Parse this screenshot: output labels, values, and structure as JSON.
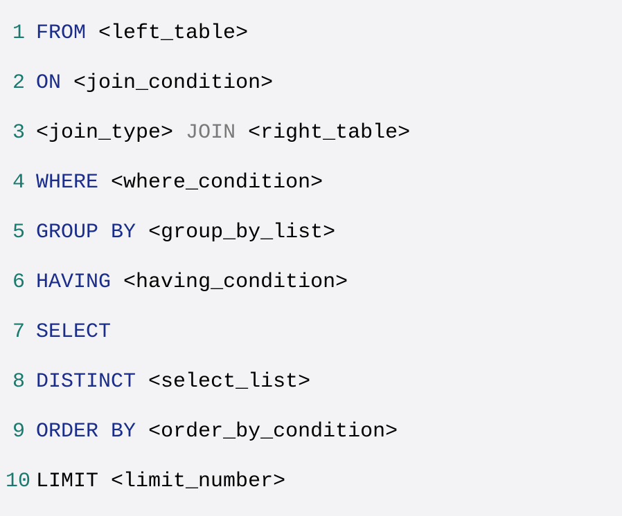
{
  "colors": {
    "background": "#f3f2f4",
    "lineNumber": "#1a7a6f",
    "keywordBlue": "#1a2d8a",
    "keywordGray": "#7a7a7a",
    "textBlack": "#000000"
  },
  "lines": [
    {
      "number": "1",
      "tokens": [
        {
          "text": "FROM",
          "class": "kw-blue"
        },
        {
          "text": " ",
          "class": "txt-black"
        },
        {
          "text": "<left_table>",
          "class": "txt-black"
        }
      ]
    },
    {
      "number": "2",
      "tokens": [
        {
          "text": "ON",
          "class": "kw-blue"
        },
        {
          "text": " ",
          "class": "txt-black"
        },
        {
          "text": "<join_condition>",
          "class": "txt-black"
        }
      ]
    },
    {
      "number": "3",
      "tokens": [
        {
          "text": "<join_type>",
          "class": "txt-black"
        },
        {
          "text": " ",
          "class": "txt-black"
        },
        {
          "text": "JOIN",
          "class": "kw-gray"
        },
        {
          "text": " ",
          "class": "txt-black"
        },
        {
          "text": "<right_table>",
          "class": "txt-black"
        }
      ]
    },
    {
      "number": "4",
      "tokens": [
        {
          "text": "WHERE",
          "class": "kw-blue"
        },
        {
          "text": " ",
          "class": "txt-black"
        },
        {
          "text": "<where_condition>",
          "class": "txt-black"
        }
      ]
    },
    {
      "number": "5",
      "tokens": [
        {
          "text": "GROUP",
          "class": "kw-blue"
        },
        {
          "text": " ",
          "class": "txt-black"
        },
        {
          "text": "BY",
          "class": "kw-blue"
        },
        {
          "text": " ",
          "class": "txt-black"
        },
        {
          "text": "<group_by_list>",
          "class": "txt-black"
        }
      ]
    },
    {
      "number": "6",
      "tokens": [
        {
          "text": "HAVING",
          "class": "kw-blue"
        },
        {
          "text": " ",
          "class": "txt-black"
        },
        {
          "text": "<having_condition>",
          "class": "txt-black"
        }
      ]
    },
    {
      "number": "7",
      "tokens": [
        {
          "text": "SELECT",
          "class": "kw-blue"
        }
      ]
    },
    {
      "number": "8",
      "tokens": [
        {
          "text": "DISTINCT",
          "class": "kw-blue"
        },
        {
          "text": " ",
          "class": "txt-black"
        },
        {
          "text": "<select_list>",
          "class": "txt-black"
        }
      ]
    },
    {
      "number": "9",
      "tokens": [
        {
          "text": "ORDER",
          "class": "kw-blue"
        },
        {
          "text": " ",
          "class": "txt-black"
        },
        {
          "text": "BY",
          "class": "kw-blue"
        },
        {
          "text": " ",
          "class": "txt-black"
        },
        {
          "text": "<order_by_condition>",
          "class": "txt-black"
        }
      ]
    },
    {
      "number": "10",
      "tokens": [
        {
          "text": "LIMIT",
          "class": "txt-black"
        },
        {
          "text": " ",
          "class": "txt-black"
        },
        {
          "text": "<limit_number>",
          "class": "txt-black"
        }
      ]
    }
  ]
}
